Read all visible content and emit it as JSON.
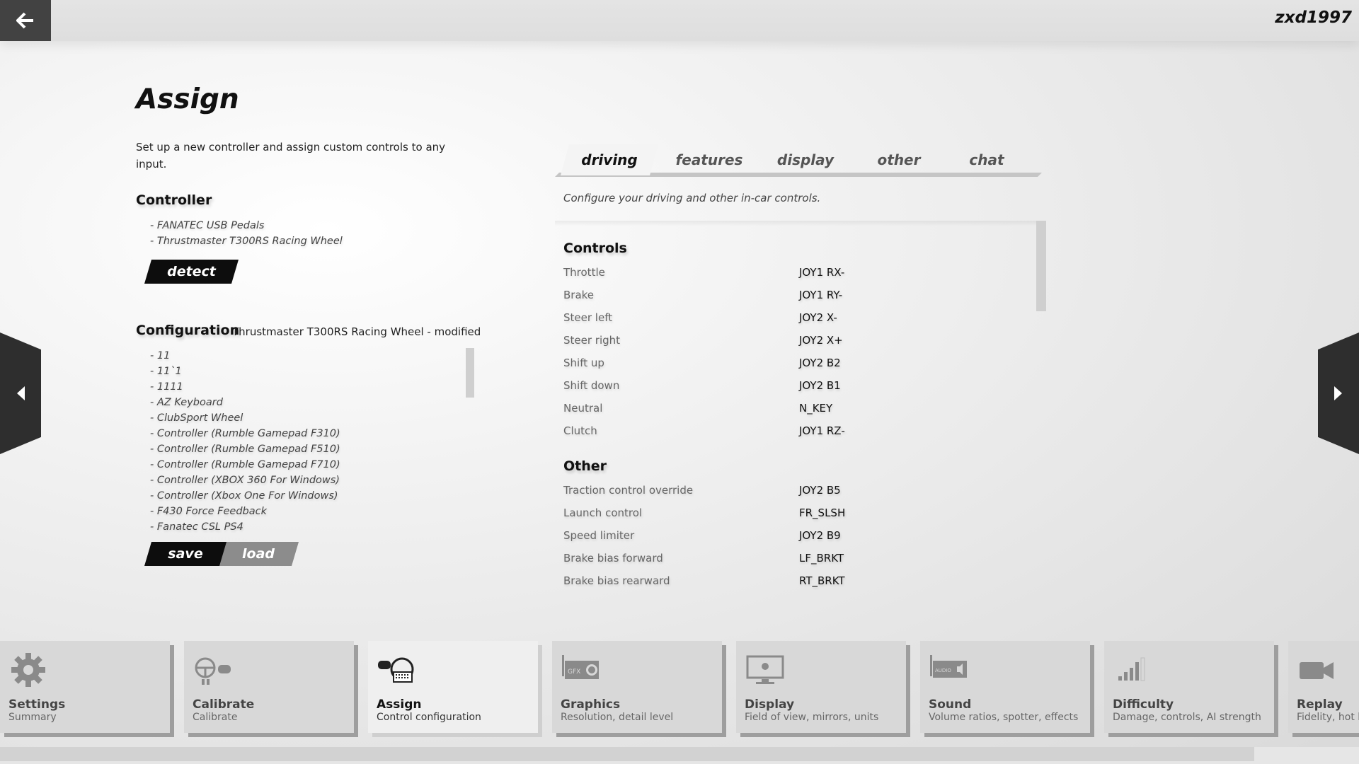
{
  "topbar": {
    "username": "zxd1997"
  },
  "page": {
    "title": "Assign",
    "description": "Set up a new controller and assign custom controls to any input."
  },
  "controller": {
    "heading": "Controller",
    "items": [
      "- FANATEC USB Pedals",
      "- Thrustmaster T300RS Racing Wheel"
    ],
    "detect_label": "detect"
  },
  "configuration": {
    "heading": "Configuration",
    "current": "Thrustmaster T300RS Racing Wheel - modified",
    "items": [
      "- 11",
      "- 11`1",
      "- 1111",
      "- AZ Keyboard",
      "- ClubSport Wheel",
      "- Controller (Rumble Gamepad F310)",
      "- Controller (Rumble Gamepad F510)",
      "- Controller (Rumble Gamepad F710)",
      "- Controller (XBOX 360 For Windows)",
      "- Controller (Xbox One For Windows)",
      "- F430 Force Feedback",
      "- Fanatec CSL PS4"
    ],
    "save_label": "save",
    "load_label": "load"
  },
  "tabs": [
    {
      "label": "driving",
      "active": true
    },
    {
      "label": "features",
      "active": false
    },
    {
      "label": "display",
      "active": false
    },
    {
      "label": "other",
      "active": false
    },
    {
      "label": "chat",
      "active": false
    }
  ],
  "tab_description": "Configure your driving and other in-car controls.",
  "bindings": {
    "controls": {
      "heading": "Controls",
      "rows": [
        {
          "label": "Throttle",
          "value": "JOY1 RX-"
        },
        {
          "label": "Brake",
          "value": "JOY1 RY-"
        },
        {
          "label": "Steer left",
          "value": "JOY2 X-"
        },
        {
          "label": "Steer right",
          "value": "JOY2 X+"
        },
        {
          "label": "Shift up",
          "value": "JOY2 B2"
        },
        {
          "label": "Shift down",
          "value": "JOY2 B1"
        },
        {
          "label": "Neutral",
          "value": "N_KEY"
        },
        {
          "label": "Clutch",
          "value": "JOY1 RZ-"
        }
      ]
    },
    "other": {
      "heading": "Other",
      "rows": [
        {
          "label": "Traction control override",
          "value": "JOY2 B5"
        },
        {
          "label": "Launch control",
          "value": "FR_SLSH"
        },
        {
          "label": "Speed limiter",
          "value": "JOY2 B9"
        },
        {
          "label": "Brake bias forward",
          "value": "LF_BRKT"
        },
        {
          "label": "Brake bias rearward",
          "value": "RT_BRKT"
        }
      ]
    }
  },
  "bottom_nav": [
    {
      "title": "Settings",
      "subtitle": "Summary",
      "icon": "gear-icon",
      "active": false
    },
    {
      "title": "Calibrate",
      "subtitle": "Calibrate",
      "icon": "wheel-gamepad-icon",
      "active": false
    },
    {
      "title": "Assign",
      "subtitle": "Control configuration",
      "icon": "gamepad-keyboard-wheel-icon",
      "active": true
    },
    {
      "title": "Graphics",
      "subtitle": "Resolution, detail level",
      "icon": "gfx-card-icon",
      "icon_text": "GFX",
      "active": false
    },
    {
      "title": "Display",
      "subtitle": "Field of view, mirrors, units",
      "icon": "monitor-icon",
      "active": false
    },
    {
      "title": "Sound",
      "subtitle": "Volume ratios, spotter, effects",
      "icon": "audio-card-icon",
      "icon_text": "AUDIO",
      "active": false
    },
    {
      "title": "Difficulty",
      "subtitle": "Damage, controls, AI strength",
      "icon": "signal-bars-icon",
      "active": false
    },
    {
      "title": "Replay",
      "subtitle": "Fidelity, hot l",
      "icon": "video-camera-icon",
      "active": false
    }
  ],
  "colors": {
    "dark_button": "#0d0d0d",
    "grey_button": "#8c8c8c",
    "topbar_back": "#424242",
    "side_arrow": "#2e2e2e"
  }
}
